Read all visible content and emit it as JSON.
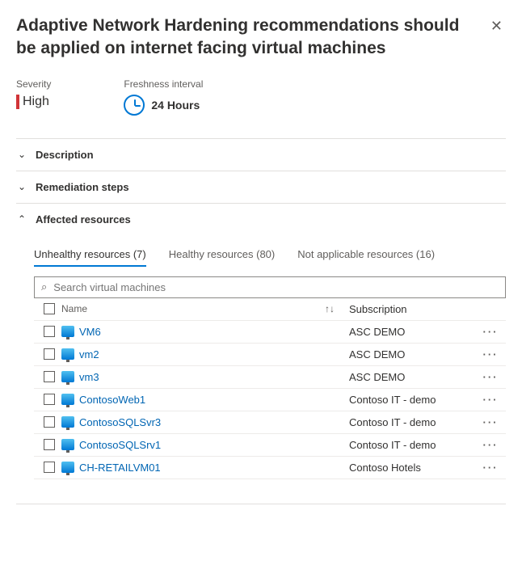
{
  "title": "Adaptive Network Hardening recommendations should be applied on internet facing virtual machines",
  "severity": {
    "label": "Severity",
    "value": "High"
  },
  "freshness": {
    "label": "Freshness interval",
    "value": "24 Hours"
  },
  "sections": {
    "description": "Description",
    "remediation": "Remediation steps",
    "affected": "Affected resources"
  },
  "tabs": {
    "unhealthy": "Unhealthy resources (7)",
    "healthy": "Healthy resources (80)",
    "na": "Not applicable resources (16)"
  },
  "search": {
    "placeholder": "Search virtual machines"
  },
  "columns": {
    "name": "Name",
    "subscription": "Subscription"
  },
  "rows": [
    {
      "name": "VM6",
      "subscription": "ASC DEMO"
    },
    {
      "name": "vm2",
      "subscription": "ASC DEMO"
    },
    {
      "name": "vm3",
      "subscription": "ASC DEMO"
    },
    {
      "name": "ContosoWeb1",
      "subscription": "Contoso IT - demo"
    },
    {
      "name": "ContosoSQLSvr3",
      "subscription": "Contoso IT - demo"
    },
    {
      "name": "ContosoSQLSrv1",
      "subscription": "Contoso IT - demo"
    },
    {
      "name": "CH-RETAILVM01",
      "subscription": "Contoso Hotels"
    }
  ]
}
